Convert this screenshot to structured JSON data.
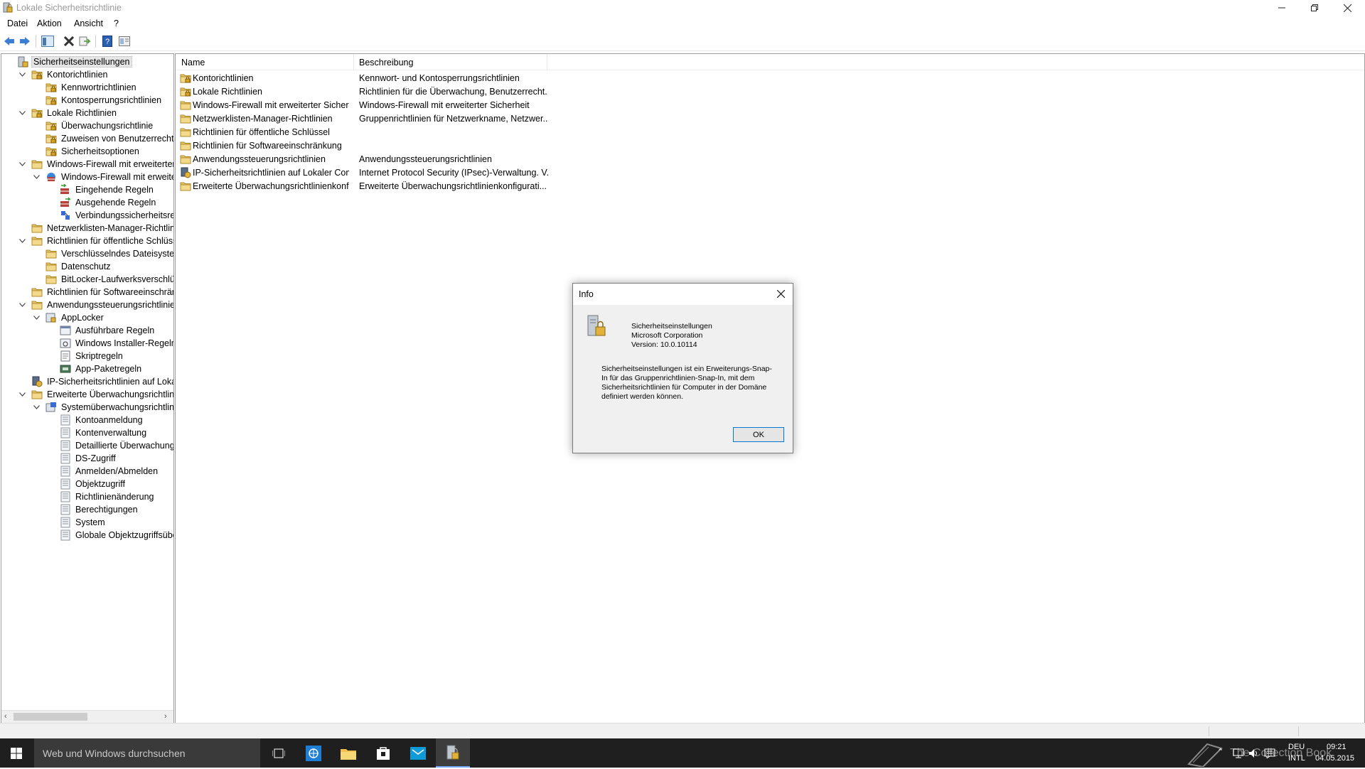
{
  "window": {
    "title": "Lokale Sicherheitsrichtlinie",
    "controls": [
      "minimize-icon",
      "restore-icon",
      "close-icon"
    ]
  },
  "menu": [
    "Datei",
    "Aktion",
    "Ansicht",
    "?"
  ],
  "toolbar": {
    "buttons": [
      "back-arrow-icon",
      "forward-arrow-icon",
      "show-hide-tree-icon",
      "delete-icon",
      "export-list-icon",
      "help-icon",
      "properties-icon"
    ]
  },
  "tree": [
    {
      "label": "Sicherheitseinstellungen",
      "level": 0,
      "expander": "",
      "icon": "security-settings-icon"
    },
    {
      "label": "Kontorichtlinien",
      "level": 1,
      "expander": "open",
      "icon": "folder-lock-icon"
    },
    {
      "label": "Kennwortrichtlinien",
      "level": 2,
      "expander": "",
      "icon": "folder-lock-icon"
    },
    {
      "label": "Kontosperrungsrichtlinien",
      "level": 2,
      "expander": "",
      "icon": "folder-lock-icon"
    },
    {
      "label": "Lokale Richtlinien",
      "level": 1,
      "expander": "open",
      "icon": "folder-lock-icon"
    },
    {
      "label": "Überwachungsrichtlinie",
      "level": 2,
      "expander": "",
      "icon": "folder-lock-icon"
    },
    {
      "label": "Zuweisen von Benutzerrechten",
      "level": 2,
      "expander": "",
      "icon": "folder-lock-icon"
    },
    {
      "label": "Sicherheitsoptionen",
      "level": 2,
      "expander": "",
      "icon": "folder-lock-icon"
    },
    {
      "label": "Windows-Firewall mit erweiterter Sich",
      "level": 1,
      "expander": "open",
      "icon": "folder-icon"
    },
    {
      "label": "Windows-Firewall mit erweiterter",
      "level": 2,
      "expander": "open",
      "icon": "firewall-icon"
    },
    {
      "label": "Eingehende Regeln",
      "level": 3,
      "expander": "",
      "icon": "inbound-rules-icon"
    },
    {
      "label": "Ausgehende Regeln",
      "level": 3,
      "expander": "",
      "icon": "outbound-rules-icon"
    },
    {
      "label": "Verbindungssicherheitsregeln",
      "level": 3,
      "expander": "",
      "icon": "connection-rules-icon"
    },
    {
      "label": "Netzwerklisten-Manager-Richtlinien",
      "level": 1,
      "expander": "",
      "icon": "folder-icon"
    },
    {
      "label": "Richtlinien für öffentliche Schlüssel",
      "level": 1,
      "expander": "open",
      "icon": "folder-icon"
    },
    {
      "label": "Verschlüsselndes Dateisystem",
      "level": 2,
      "expander": "",
      "icon": "folder-icon"
    },
    {
      "label": "Datenschutz",
      "level": 2,
      "expander": "",
      "icon": "folder-icon"
    },
    {
      "label": "BitLocker-Laufwerksverschlüsselu",
      "level": 2,
      "expander": "",
      "icon": "folder-icon"
    },
    {
      "label": "Richtlinien für Softwareeinschränkung",
      "level": 1,
      "expander": "",
      "icon": "folder-icon"
    },
    {
      "label": "Anwendungssteuerungsrichtlinien",
      "level": 1,
      "expander": "open",
      "icon": "folder-icon"
    },
    {
      "label": "AppLocker",
      "level": 2,
      "expander": "open",
      "icon": "applocker-icon"
    },
    {
      "label": "Ausführbare Regeln",
      "level": 3,
      "expander": "",
      "icon": "rules-icon"
    },
    {
      "label": "Windows Installer-Regeln",
      "level": 3,
      "expander": "",
      "icon": "installer-rules-icon"
    },
    {
      "label": "Skriptregeln",
      "level": 3,
      "expander": "",
      "icon": "script-rules-icon"
    },
    {
      "label": "App-Paketregeln",
      "level": 3,
      "expander": "",
      "icon": "app-package-rules-icon"
    },
    {
      "label": "IP-Sicherheitsrichtlinien auf Lokaler C",
      "level": 1,
      "expander": "",
      "icon": "ipsec-icon"
    },
    {
      "label": "Erweiterte Überwachungsrichtlinienk",
      "level": 1,
      "expander": "open",
      "icon": "folder-icon"
    },
    {
      "label": "Systemüberwachungsrichtlinien -",
      "level": 2,
      "expander": "open",
      "icon": "audit-policy-icon"
    },
    {
      "label": "Kontoanmeldung",
      "level": 3,
      "expander": "",
      "icon": "audit-item-icon"
    },
    {
      "label": "Kontenverwaltung",
      "level": 3,
      "expander": "",
      "icon": "audit-item-icon"
    },
    {
      "label": "Detaillierte Überwachung",
      "level": 3,
      "expander": "",
      "icon": "audit-item-icon"
    },
    {
      "label": "DS-Zugriff",
      "level": 3,
      "expander": "",
      "icon": "audit-item-icon"
    },
    {
      "label": "Anmelden/Abmelden",
      "level": 3,
      "expander": "",
      "icon": "audit-item-icon"
    },
    {
      "label": "Objektzugriff",
      "level": 3,
      "expander": "",
      "icon": "audit-item-icon"
    },
    {
      "label": "Richtlinienänderung",
      "level": 3,
      "expander": "",
      "icon": "audit-item-icon"
    },
    {
      "label": "Berechtigungen",
      "level": 3,
      "expander": "",
      "icon": "audit-item-icon"
    },
    {
      "label": "System",
      "level": 3,
      "expander": "",
      "icon": "audit-item-icon"
    },
    {
      "label": "Globale Objektzugriffsüberwac",
      "level": 3,
      "expander": "",
      "icon": "audit-item-icon"
    }
  ],
  "list": {
    "columns": [
      "Name",
      "Beschreibung"
    ],
    "rows": [
      {
        "name": "Kontorichtlinien",
        "desc": "Kennwort- und Kontosperrungsrichtlinien",
        "icon": "folder-lock-icon"
      },
      {
        "name": "Lokale Richtlinien",
        "desc": "Richtlinien für die Überwachung, Benutzerrecht...",
        "icon": "folder-lock-icon"
      },
      {
        "name": "Windows-Firewall mit erweiterter Sicherh...",
        "desc": "Windows-Firewall mit erweiterter Sicherheit",
        "icon": "folder-icon"
      },
      {
        "name": "Netzwerklisten-Manager-Richtlinien",
        "desc": "Gruppenrichtlinien für Netzwerkname, Netzwer...",
        "icon": "folder-icon"
      },
      {
        "name": "Richtlinien für öffentliche Schlüssel",
        "desc": "",
        "icon": "folder-icon"
      },
      {
        "name": "Richtlinien für Softwareeinschränkung",
        "desc": "",
        "icon": "folder-icon"
      },
      {
        "name": "Anwendungssteuerungsrichtlinien",
        "desc": "Anwendungssteuerungsrichtlinien",
        "icon": "folder-icon"
      },
      {
        "name": "IP-Sicherheitsrichtlinien auf Lokaler Com...",
        "desc": "Internet Protocol Security (IPsec)-Verwaltung. V...",
        "icon": "ipsec-icon"
      },
      {
        "name": "Erweiterte Überwachungsrichtlinienkonfi...",
        "desc": "Erweiterte Überwachungsrichtlinienkonfigurati...",
        "icon": "folder-icon"
      }
    ]
  },
  "dialog": {
    "title": "Info",
    "product": "Sicherheitseinstellungen",
    "company": "Microsoft Corporation",
    "version": "Version: 10.0.10114",
    "text": "Sicherheitseinstellungen ist ein Erweiterungs-Snap-In für das Gruppenrichtlinien-Snap-In, mit dem Sicherheitsrichtlinien für Computer in der Domäne definiert werden können.",
    "ok": "OK"
  },
  "taskbar": {
    "search_placeholder": "Web und Windows durchsuchen",
    "watermark": "The Collection Book",
    "lang_top": "DEU",
    "lang_bottom": "INTL",
    "time": "09:21",
    "date": "04.05.2015"
  },
  "colors": {
    "accent": "#0078d7",
    "taskbar": "#1f1f1f",
    "folder": "#e8c46a"
  }
}
